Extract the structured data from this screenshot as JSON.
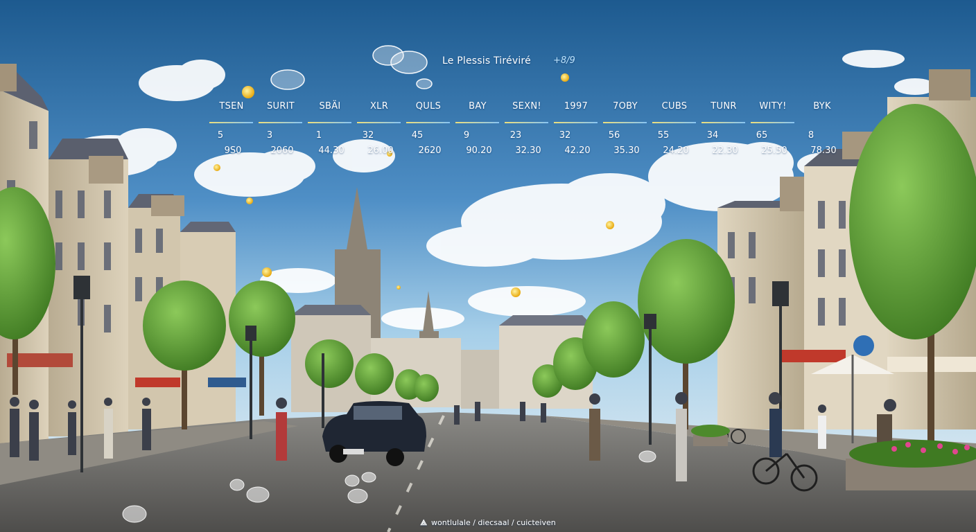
{
  "header": {
    "title": "Le Plessis Tiréviré",
    "title_value": "+8/9"
  },
  "forecast": {
    "labels": [
      "TSEN",
      "SURIT",
      "SBÄI",
      "XLR",
      "QULS",
      "BAY",
      "SEXN!",
      "1997",
      "7OBY",
      "CUBS",
      "TUNR",
      "WITY!",
      "BYK"
    ],
    "numbers": [
      "5",
      "3",
      "1",
      "32",
      "45",
      "9",
      "23",
      "32",
      "56",
      "55",
      "34",
      "65",
      "8"
    ],
    "values": [
      "9S0",
      "2060",
      "44.30",
      "26.00",
      "2620",
      "90.20",
      "32.30",
      "42.20",
      "35.30",
      "24.20",
      "22.30",
      "25.50",
      "78.30"
    ]
  },
  "footer": {
    "text": "wontlulale / diecsaal / cuicteiven"
  },
  "colors": {
    "sky_top": "#1f5f95",
    "sky_bottom": "#a9d3ee",
    "accent_sun": "#f5c518",
    "stone": "#cbbfa6",
    "tree": "#5fa033",
    "cobble": "#6e6d6a"
  }
}
